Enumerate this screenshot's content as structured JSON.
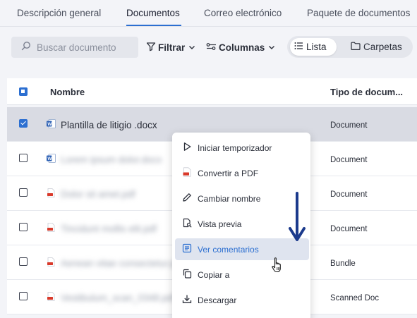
{
  "tabs": [
    {
      "label": "Descripción general",
      "active": false
    },
    {
      "label": "Documentos",
      "active": true
    },
    {
      "label": "Correo electrónico",
      "active": false
    },
    {
      "label": "Paquete de documentos",
      "active": false
    }
  ],
  "toolbar": {
    "search_placeholder": "Buscar documento",
    "filter_label": "Filtrar",
    "columns_label": "Columnas",
    "list_label": "Lista",
    "folders_label": "Carpetas",
    "active_view": "Lista"
  },
  "table": {
    "col_name": "Nombre",
    "col_type": "Tipo de docum...",
    "rows": [
      {
        "name": "Plantilla de litigio .docx",
        "type": "Document",
        "icon": "word-file-icon",
        "selected": true,
        "obscured": false
      },
      {
        "name": "Lorem ipsum dolor.docx",
        "type": "Document",
        "icon": "word-file-icon",
        "selected": false,
        "obscured": true
      },
      {
        "name": "Dolor sit amet.pdf",
        "type": "Document",
        "icon": "pdf-file-icon",
        "selected": false,
        "obscured": true
      },
      {
        "name": "Tincidunt mollis elit.pdf",
        "type": "Document",
        "icon": "pdf-file-icon",
        "selected": false,
        "obscured": true
      },
      {
        "name": "Aenean vitae consectetur.pdf",
        "type": "Bundle",
        "icon": "pdf-file-icon",
        "selected": false,
        "obscured": true
      },
      {
        "name": "Vestibulum_scan_0348.pdf",
        "type": "Scanned Doc",
        "icon": "pdf-file-icon",
        "selected": false,
        "obscured": true
      }
    ]
  },
  "context_menu": {
    "items": [
      {
        "label": "Iniciar temporizador",
        "icon": "play-icon"
      },
      {
        "label": "Convertir a PDF",
        "icon": "pdf-file-icon"
      },
      {
        "label": "Cambiar nombre",
        "icon": "pencil-icon"
      },
      {
        "label": "Vista previa",
        "icon": "preview-icon"
      },
      {
        "label": "Ver comentarios",
        "icon": "comments-icon",
        "highlighted": true
      },
      {
        "label": "Copiar a",
        "icon": "copy-icon"
      },
      {
        "label": "Descargar",
        "icon": "download-icon"
      }
    ]
  },
  "colors": {
    "accent": "#2c6fd1",
    "arrow": "#1b3a8c",
    "pdf_red": "#d93a2b",
    "word_blue": "#2b5fb4"
  }
}
